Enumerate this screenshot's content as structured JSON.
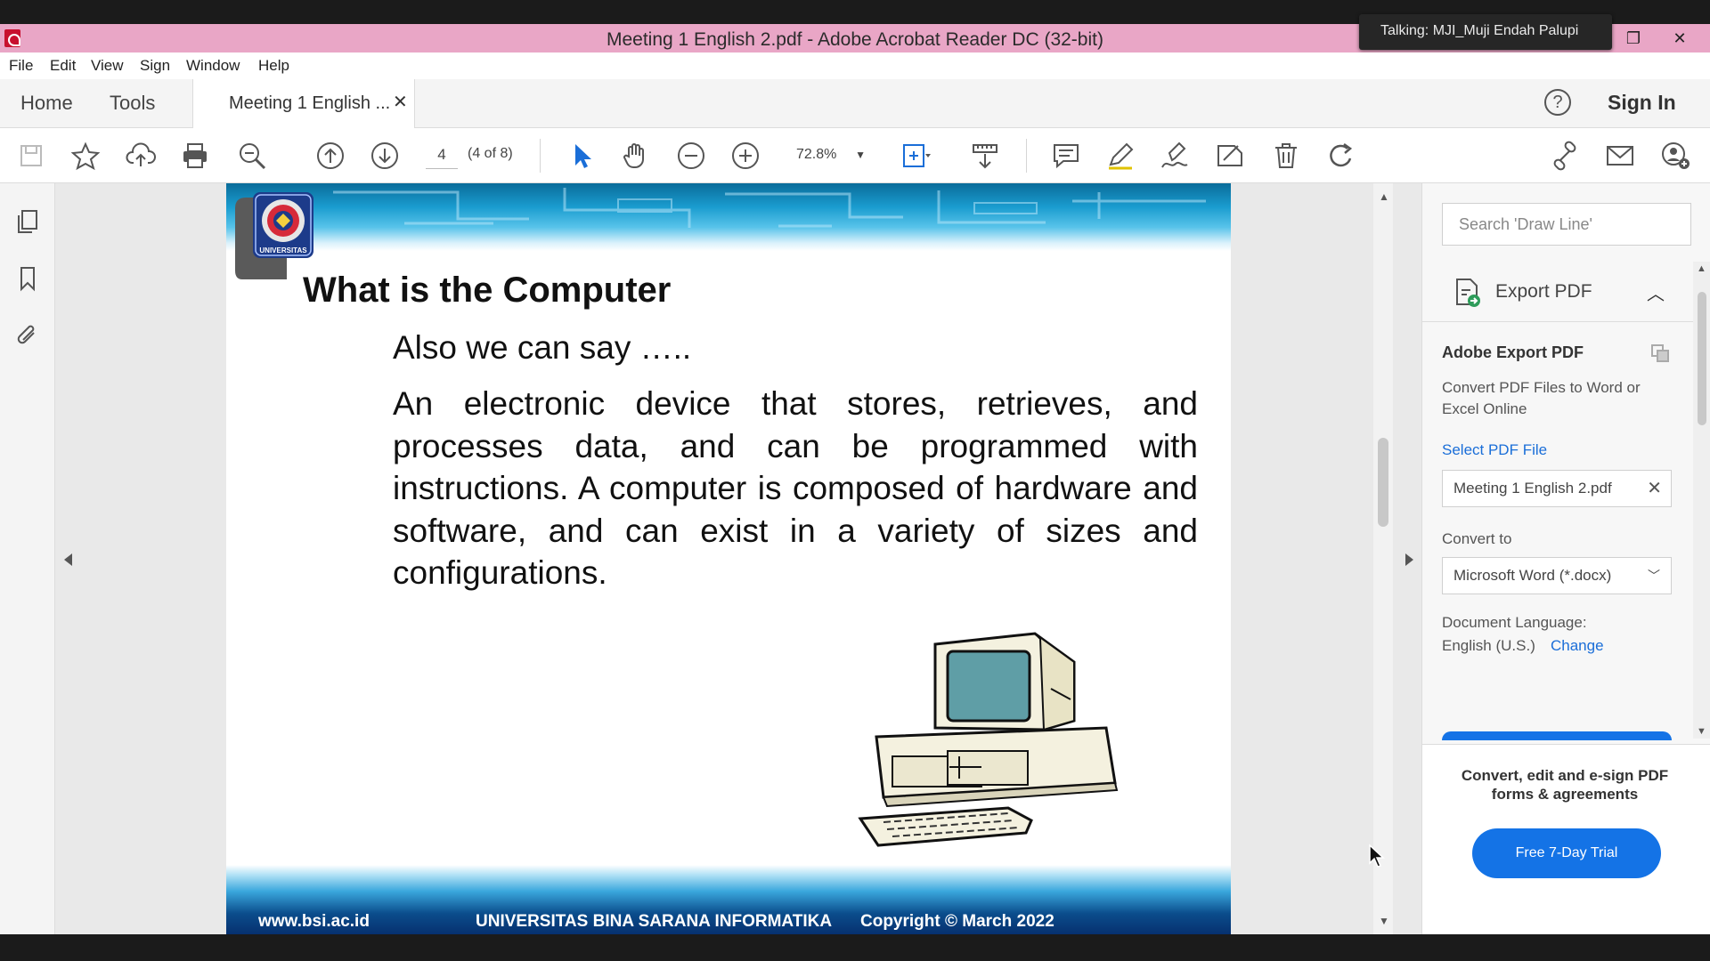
{
  "window": {
    "title": "Meeting 1 English 2.pdf - Adobe Acrobat Reader DC (32-bit)",
    "talking": "Talking: MJI_Muji Endah Palupi"
  },
  "menu": [
    "File",
    "Edit",
    "View",
    "Sign",
    "Window",
    "Help"
  ],
  "tabs": {
    "home": "Home",
    "tools": "Tools",
    "document": "Meeting 1 English ...",
    "sign_in": "Sign In"
  },
  "toolbar": {
    "page_number": "4",
    "page_count": "(4 of 8)",
    "zoom": "72.8%"
  },
  "slide": {
    "title": "What is the Computer",
    "subtitle": "Also we can say …..",
    "body": "An electronic device that stores, retrieves, and processes data, and can be programmed with instructions. A computer is composed of hardware and software, and can exist in a variety of sizes and configurations.",
    "logo_text": "UNIVERSITAS",
    "footer_left": "www.bsi.ac.id",
    "footer_center": "UNIVERSITAS BINA SARANA INFORMATIKA",
    "footer_right": "Copyright © March 2022"
  },
  "right_panel": {
    "search_placeholder": "Search 'Draw Line'",
    "export_header": "Export PDF",
    "adobe_export": "Adobe Export PDF",
    "description": "Convert PDF Files to Word or Excel Online",
    "select_file": "Select PDF File",
    "file_name": "Meeting 1 English 2.pdf",
    "convert_to_label": "Convert to",
    "convert_to_value": "Microsoft Word (*.docx)",
    "doc_language_label": "Document Language:",
    "doc_language_value": "English (U.S.)",
    "change": "Change",
    "promo": "Convert, edit and e-sign PDF forms & agreements",
    "trial_button": "Free 7-Day Trial"
  },
  "colors": {
    "titlebar": "#e9a6c6",
    "accent_blue": "#1473e6",
    "link_blue": "#1a6ed8"
  }
}
